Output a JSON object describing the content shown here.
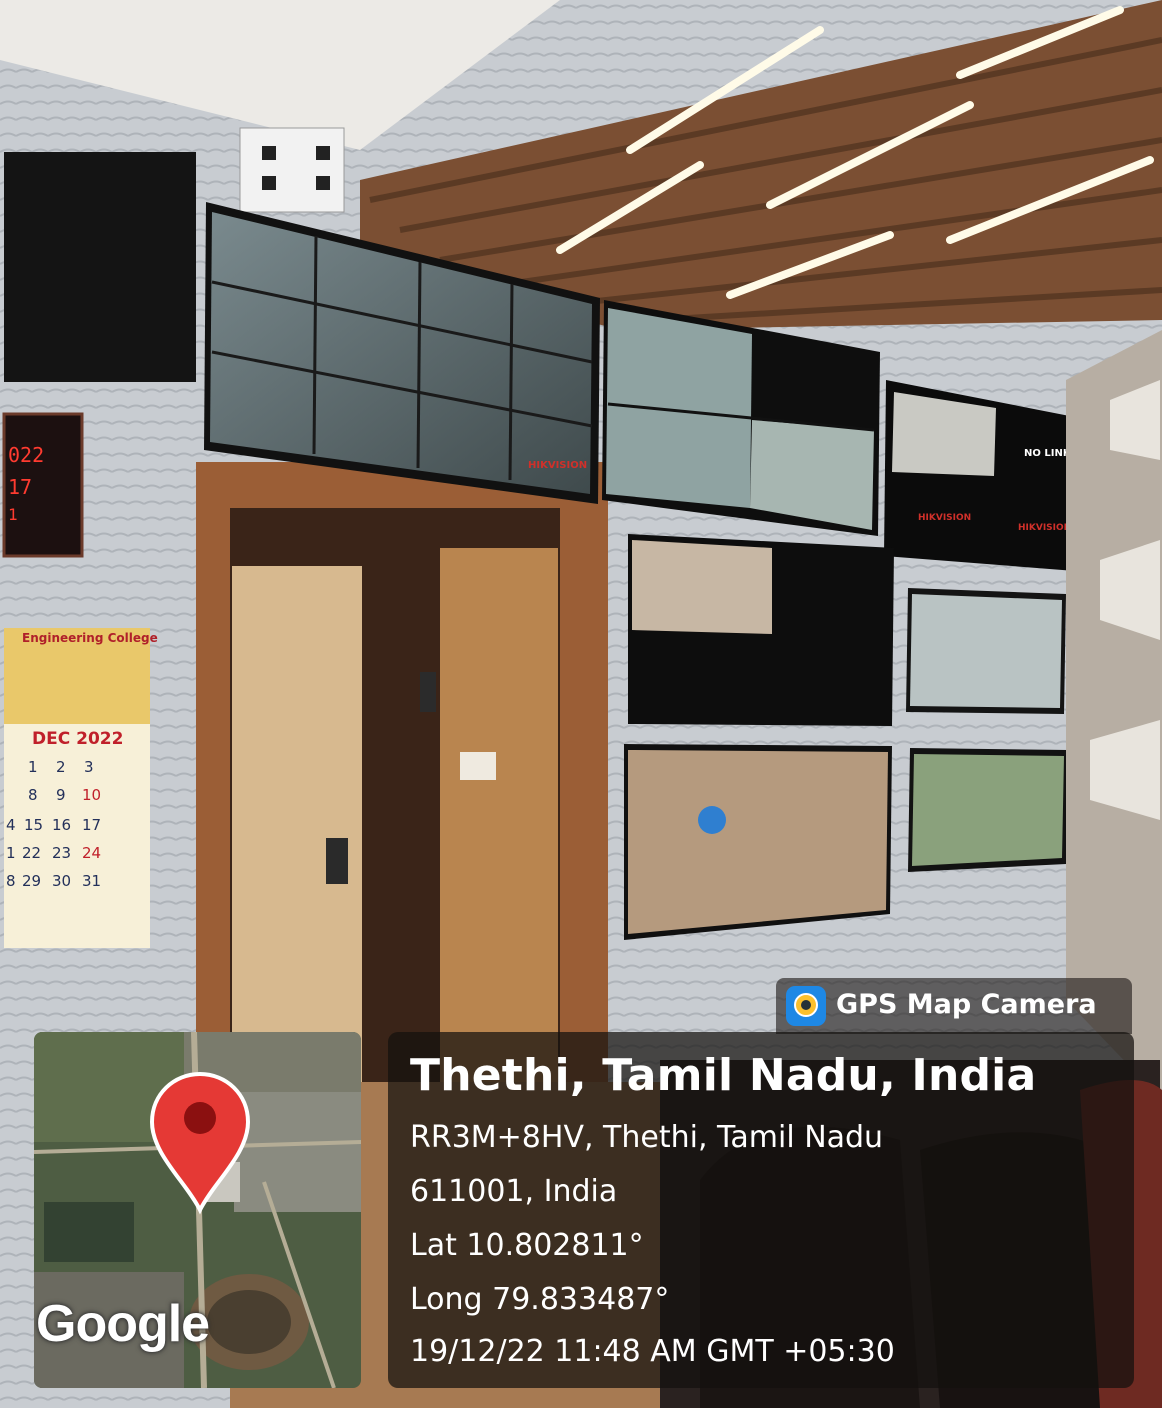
{
  "overlay": {
    "place": "Thethi, Tamil Nadu, India",
    "address_line1": "RR3M+8HV, Thethi, Tamil Nadu",
    "address_line2": "611001, India",
    "latitude": "Lat 10.802811°",
    "longitude": "Long 79.833487°",
    "timestamp": "19/12/22 11:48 AM GMT +05:30"
  },
  "brand": {
    "label": "GPS Map Camera",
    "icon": "camera-app-icon"
  },
  "map": {
    "logo": "Google",
    "pin_icon": "map-pin-icon"
  },
  "scene_text": {
    "calendar_header": "Engineering College",
    "calendar_month": "DEC 2022",
    "calendar_rows": [
      [
        "1",
        "2",
        "3"
      ],
      [
        "8",
        "9",
        "10"
      ],
      [
        "4",
        "15",
        "16",
        "17"
      ],
      [
        "1",
        "22",
        "23",
        "24"
      ],
      [
        "8",
        "29",
        "30",
        "31"
      ]
    ],
    "clock_readings": [
      "022",
      "17",
      "1"
    ],
    "monitor_brand_a": "HIKVISION",
    "monitor_brand_b": "HIKVISION",
    "monitor_brand_c": "HIKVISION",
    "no_link": "NO LINK"
  },
  "colors": {
    "pin": "#e53935",
    "overlay_text": "#ffffff",
    "ceiling_wood": "#8a5a3a",
    "door_wood": "#b07a4f"
  }
}
